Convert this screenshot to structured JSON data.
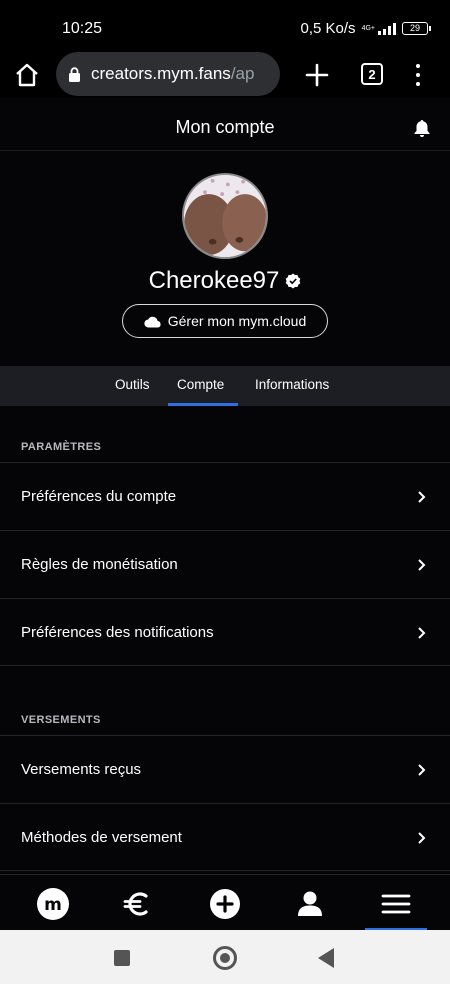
{
  "status_bar": {
    "time": "10:25",
    "speed": "0,5 Ko/s",
    "network": "4G+",
    "battery": "29"
  },
  "browser": {
    "url_host": "creators.mym.fans",
    "url_path": "/ap",
    "tab_count": "2"
  },
  "header": {
    "title": "Mon compte"
  },
  "profile": {
    "username": "Cherokee97",
    "cloud_button": "Gérer mon mym.cloud"
  },
  "tabs": [
    {
      "label": "Outils",
      "active": false
    },
    {
      "label": "Compte",
      "active": true
    },
    {
      "label": "Informations",
      "active": false
    }
  ],
  "sections": {
    "parametres": {
      "label": "PARAMÈTRES",
      "items": [
        "Préférences du compte",
        "Règles de monétisation",
        "Préférences des notifications"
      ]
    },
    "versements": {
      "label": "VERSEMENTS",
      "items": [
        "Versements reçus",
        "Méthodes de versement"
      ]
    }
  },
  "bottom_nav": {
    "logo_letter": "m",
    "items": [
      "home-logo",
      "euro-icon",
      "plus-circle-icon",
      "user-icon",
      "hamburger-icon"
    ],
    "active": "hamburger-icon"
  },
  "colors": {
    "accent": "#2f6fe0",
    "background": "#050508",
    "tab_bar": "#1d1e23"
  }
}
